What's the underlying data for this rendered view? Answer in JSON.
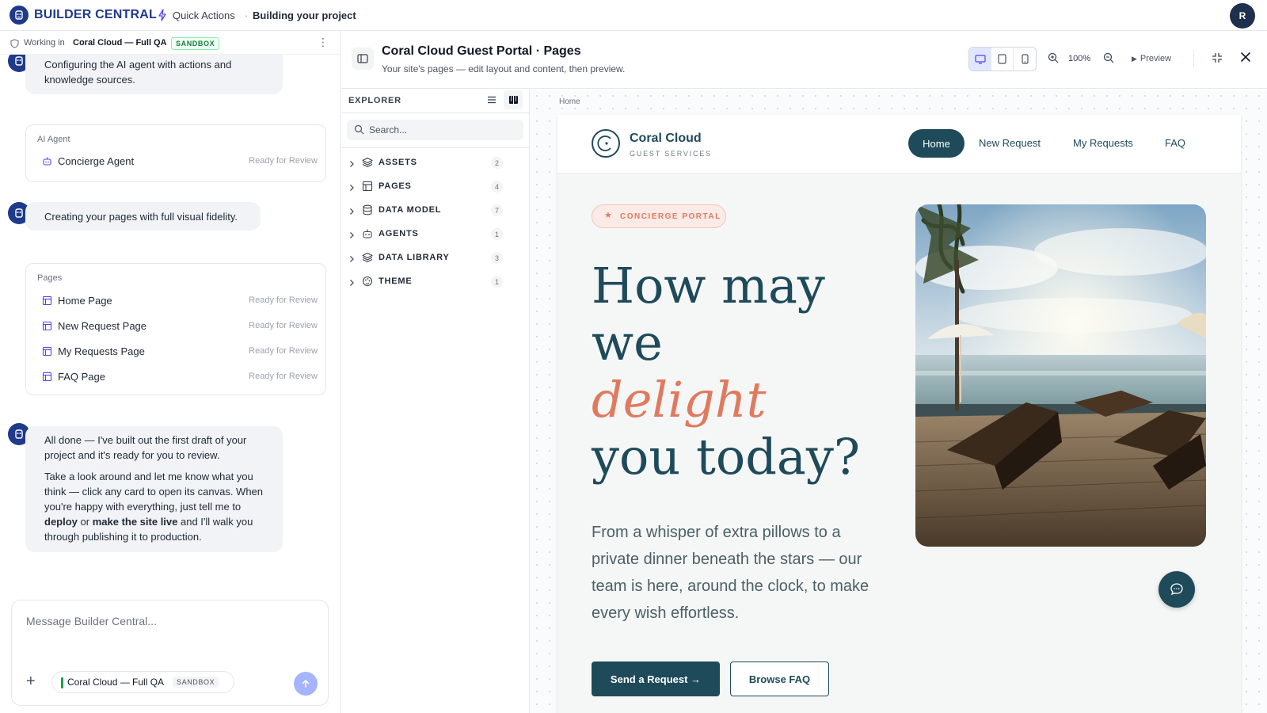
{
  "app": {
    "brand": "BUILDER CENTRAL",
    "quick_actions": "Quick Actions",
    "separator": "·",
    "status": "Building your project",
    "user_initial": "R"
  },
  "workspace": {
    "label": "Working in",
    "name": "Coral Cloud — Full QA",
    "badge": "SANDBOX"
  },
  "chat": {
    "msg_configuring": "Configuring the AI agent with actions and knowledge sources.",
    "agent_card": {
      "title": "AI Agent",
      "items": [
        {
          "label": "Concierge Agent",
          "status": "Ready for Review",
          "icon": "agent-icon"
        }
      ]
    },
    "msg_creating": "Creating your pages with full visual fidelity.",
    "pages_card": {
      "title": "Pages",
      "items": [
        {
          "label": "Home Page",
          "status": "Ready for Review",
          "icon": "page-icon"
        },
        {
          "label": "New Request Page",
          "status": "Ready for Review",
          "icon": "page-icon"
        },
        {
          "label": "My Requests Page",
          "status": "Ready for Review",
          "icon": "page-icon"
        },
        {
          "label": "FAQ Page",
          "status": "Ready for Review",
          "icon": "page-icon"
        }
      ]
    },
    "done_p1": "All done — I've built out the first draft of your project and it's ready for you to review.",
    "done_p2_a": "Take a look around and let me know what you think — click any card to open its canvas. When you're happy with everything, just tell me to ",
    "done_p2_deploy": "deploy",
    "done_p2_or": " or ",
    "done_p2_live": "make the site live",
    "done_p2_b": " and I'll walk you through publishing it to production."
  },
  "composer": {
    "placeholder": "Message Builder Central...",
    "context_name": "Coral Cloud — Full QA",
    "context_badge": "SANDBOX"
  },
  "canvas": {
    "title": "Coral Cloud Guest Portal · Pages",
    "subtitle": "Your site's pages — edit layout and content, then preview.",
    "zoom": "100%",
    "preview": "Preview",
    "active_device": "desktop"
  },
  "explorer": {
    "title": "EXPLORER",
    "search_placeholder": "Search...",
    "items": [
      {
        "label": "ASSETS",
        "count": "2",
        "icon": "stack-icon"
      },
      {
        "label": "PAGES",
        "count": "4",
        "icon": "page-layout-icon"
      },
      {
        "label": "DATA MODEL",
        "count": "7",
        "icon": "database-icon"
      },
      {
        "label": "AGENTS",
        "count": "1",
        "icon": "agent-icon"
      },
      {
        "label": "DATA LIBRARY",
        "count": "3",
        "icon": "stack-icon"
      },
      {
        "label": "THEME",
        "count": "1",
        "icon": "palette-icon"
      }
    ]
  },
  "site": {
    "breadcrumb": "Home",
    "brand_name": "Coral Cloud",
    "brand_tag": "GUEST SERVICES",
    "nav": [
      "Home",
      "New Request",
      "My Requests",
      "FAQ"
    ],
    "pill": "CONCIERGE PORTAL",
    "hero_line1": "How may",
    "hero_line2": "we",
    "hero_accent": "delight",
    "hero_line4": "you today?",
    "lede": "From a whisper of extra pillows to a private dinner beneath the stars — our team is here, around the clock, to make every wish effortless.",
    "cta_primary": "Send a Request →",
    "cta_secondary": "Browse FAQ",
    "colors": {
      "primary": "#1e4a5a",
      "accent": "#e07a5f",
      "brand": "#1e3a8a"
    }
  }
}
